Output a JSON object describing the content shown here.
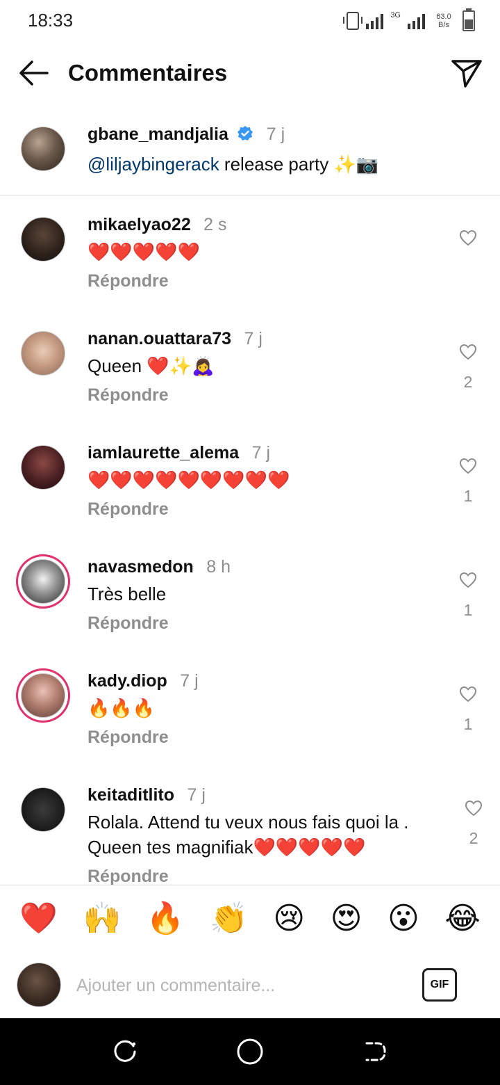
{
  "status_bar": {
    "time": "18:33",
    "network": "3G",
    "speed_value": "63.0",
    "speed_unit": "B/s"
  },
  "header": {
    "title": "Commentaires",
    "back_icon": "arrow-left-icon",
    "share_icon": "paper-plane-icon"
  },
  "caption": {
    "username": "gbane_mandjalia",
    "verified": true,
    "time": "7 j",
    "mention": "@liljaybingerack",
    "text": " release party ✨📷"
  },
  "comments": [
    {
      "username": "mikaelyao22",
      "time": "2 s",
      "text": "❤️❤️❤️❤️❤️",
      "reply": "Répondre",
      "likes": ""
    },
    {
      "username": "nanan.ouattara73",
      "time": "7 j",
      "text": "Queen ❤️✨🙇‍♀️",
      "reply": "Répondre",
      "likes": "2"
    },
    {
      "username": "iamlaurette_alema",
      "time": "7 j",
      "text": "❤️❤️❤️❤️❤️❤️❤️❤️❤️",
      "reply": "Répondre",
      "likes": "1"
    },
    {
      "username": "navasmedon",
      "time": "8 h",
      "text": "Très belle",
      "reply": "Répondre",
      "likes": "1"
    },
    {
      "username": "kady.diop",
      "time": "7 j",
      "text": "🔥🔥🔥",
      "reply": "Répondre",
      "likes": "1"
    },
    {
      "username": "keitaditlito",
      "time": "7 j",
      "text": "Rolala. Attend tu veux nous fais quoi la . Queen tes magnifiak❤️❤️❤️❤️❤️",
      "reply": "Répondre",
      "likes": "2"
    }
  ],
  "emoji_bar": [
    "❤️",
    "🙌",
    "🔥",
    "👏",
    "😢",
    "😍",
    "😮",
    "😂"
  ],
  "input": {
    "placeholder": "Ajouter un commentaire...",
    "gif_label": "GIF"
  },
  "colors": {
    "mention": "#00376b",
    "muted": "#8e8e8e",
    "verified": "#3897f0",
    "story_ring": "#e1306c"
  }
}
